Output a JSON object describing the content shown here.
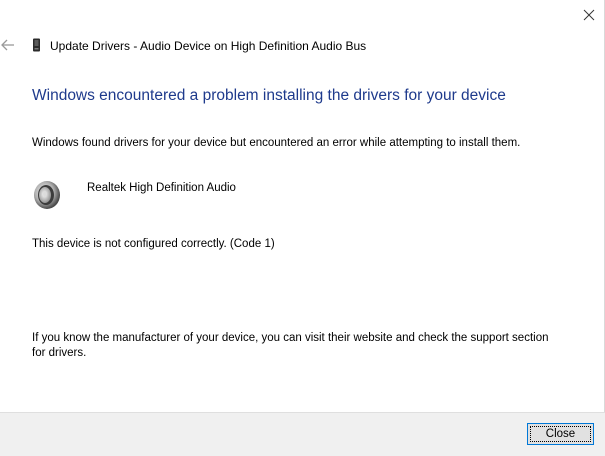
{
  "window": {
    "title": "Update Drivers - Audio Device on High Definition Audio Bus"
  },
  "main": {
    "heading": "Windows encountered a problem installing the drivers for your device",
    "description": "Windows found drivers for your device but encountered an error while attempting to install them.",
    "device_name": "Realtek High Definition Audio",
    "device_icon": "speaker-icon",
    "status": "This device is not configured correctly. (Code 1)",
    "support_text": "If you know the manufacturer of your device, you can visit their website and check the support section for drivers."
  },
  "footer": {
    "close_label": "Close"
  },
  "colors": {
    "heading": "#1e3a8c",
    "footer_bg": "#f0f0f0",
    "button_border": "#0078d7"
  }
}
